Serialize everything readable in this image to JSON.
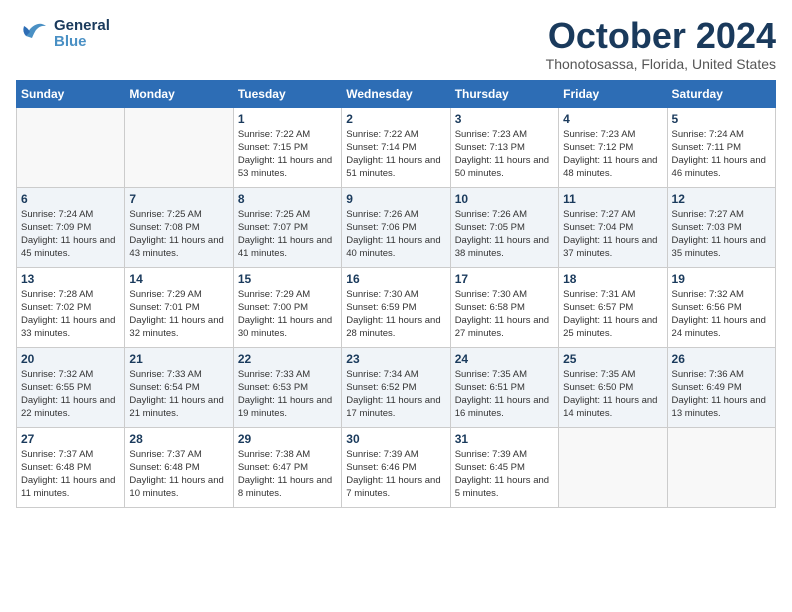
{
  "header": {
    "logo_general": "General",
    "logo_blue": "Blue",
    "month_title": "October 2024",
    "location": "Thonotosassa, Florida, United States"
  },
  "days_of_week": [
    "Sunday",
    "Monday",
    "Tuesday",
    "Wednesday",
    "Thursday",
    "Friday",
    "Saturday"
  ],
  "weeks": [
    [
      {
        "day": "",
        "info": ""
      },
      {
        "day": "",
        "info": ""
      },
      {
        "day": "1",
        "info": "Sunrise: 7:22 AM\nSunset: 7:15 PM\nDaylight: 11 hours and 53 minutes."
      },
      {
        "day": "2",
        "info": "Sunrise: 7:22 AM\nSunset: 7:14 PM\nDaylight: 11 hours and 51 minutes."
      },
      {
        "day": "3",
        "info": "Sunrise: 7:23 AM\nSunset: 7:13 PM\nDaylight: 11 hours and 50 minutes."
      },
      {
        "day": "4",
        "info": "Sunrise: 7:23 AM\nSunset: 7:12 PM\nDaylight: 11 hours and 48 minutes."
      },
      {
        "day": "5",
        "info": "Sunrise: 7:24 AM\nSunset: 7:11 PM\nDaylight: 11 hours and 46 minutes."
      }
    ],
    [
      {
        "day": "6",
        "info": "Sunrise: 7:24 AM\nSunset: 7:09 PM\nDaylight: 11 hours and 45 minutes."
      },
      {
        "day": "7",
        "info": "Sunrise: 7:25 AM\nSunset: 7:08 PM\nDaylight: 11 hours and 43 minutes."
      },
      {
        "day": "8",
        "info": "Sunrise: 7:25 AM\nSunset: 7:07 PM\nDaylight: 11 hours and 41 minutes."
      },
      {
        "day": "9",
        "info": "Sunrise: 7:26 AM\nSunset: 7:06 PM\nDaylight: 11 hours and 40 minutes."
      },
      {
        "day": "10",
        "info": "Sunrise: 7:26 AM\nSunset: 7:05 PM\nDaylight: 11 hours and 38 minutes."
      },
      {
        "day": "11",
        "info": "Sunrise: 7:27 AM\nSunset: 7:04 PM\nDaylight: 11 hours and 37 minutes."
      },
      {
        "day": "12",
        "info": "Sunrise: 7:27 AM\nSunset: 7:03 PM\nDaylight: 11 hours and 35 minutes."
      }
    ],
    [
      {
        "day": "13",
        "info": "Sunrise: 7:28 AM\nSunset: 7:02 PM\nDaylight: 11 hours and 33 minutes."
      },
      {
        "day": "14",
        "info": "Sunrise: 7:29 AM\nSunset: 7:01 PM\nDaylight: 11 hours and 32 minutes."
      },
      {
        "day": "15",
        "info": "Sunrise: 7:29 AM\nSunset: 7:00 PM\nDaylight: 11 hours and 30 minutes."
      },
      {
        "day": "16",
        "info": "Sunrise: 7:30 AM\nSunset: 6:59 PM\nDaylight: 11 hours and 28 minutes."
      },
      {
        "day": "17",
        "info": "Sunrise: 7:30 AM\nSunset: 6:58 PM\nDaylight: 11 hours and 27 minutes."
      },
      {
        "day": "18",
        "info": "Sunrise: 7:31 AM\nSunset: 6:57 PM\nDaylight: 11 hours and 25 minutes."
      },
      {
        "day": "19",
        "info": "Sunrise: 7:32 AM\nSunset: 6:56 PM\nDaylight: 11 hours and 24 minutes."
      }
    ],
    [
      {
        "day": "20",
        "info": "Sunrise: 7:32 AM\nSunset: 6:55 PM\nDaylight: 11 hours and 22 minutes."
      },
      {
        "day": "21",
        "info": "Sunrise: 7:33 AM\nSunset: 6:54 PM\nDaylight: 11 hours and 21 minutes."
      },
      {
        "day": "22",
        "info": "Sunrise: 7:33 AM\nSunset: 6:53 PM\nDaylight: 11 hours and 19 minutes."
      },
      {
        "day": "23",
        "info": "Sunrise: 7:34 AM\nSunset: 6:52 PM\nDaylight: 11 hours and 17 minutes."
      },
      {
        "day": "24",
        "info": "Sunrise: 7:35 AM\nSunset: 6:51 PM\nDaylight: 11 hours and 16 minutes."
      },
      {
        "day": "25",
        "info": "Sunrise: 7:35 AM\nSunset: 6:50 PM\nDaylight: 11 hours and 14 minutes."
      },
      {
        "day": "26",
        "info": "Sunrise: 7:36 AM\nSunset: 6:49 PM\nDaylight: 11 hours and 13 minutes."
      }
    ],
    [
      {
        "day": "27",
        "info": "Sunrise: 7:37 AM\nSunset: 6:48 PM\nDaylight: 11 hours and 11 minutes."
      },
      {
        "day": "28",
        "info": "Sunrise: 7:37 AM\nSunset: 6:48 PM\nDaylight: 11 hours and 10 minutes."
      },
      {
        "day": "29",
        "info": "Sunrise: 7:38 AM\nSunset: 6:47 PM\nDaylight: 11 hours and 8 minutes."
      },
      {
        "day": "30",
        "info": "Sunrise: 7:39 AM\nSunset: 6:46 PM\nDaylight: 11 hours and 7 minutes."
      },
      {
        "day": "31",
        "info": "Sunrise: 7:39 AM\nSunset: 6:45 PM\nDaylight: 11 hours and 5 minutes."
      },
      {
        "day": "",
        "info": ""
      },
      {
        "day": "",
        "info": ""
      }
    ]
  ]
}
